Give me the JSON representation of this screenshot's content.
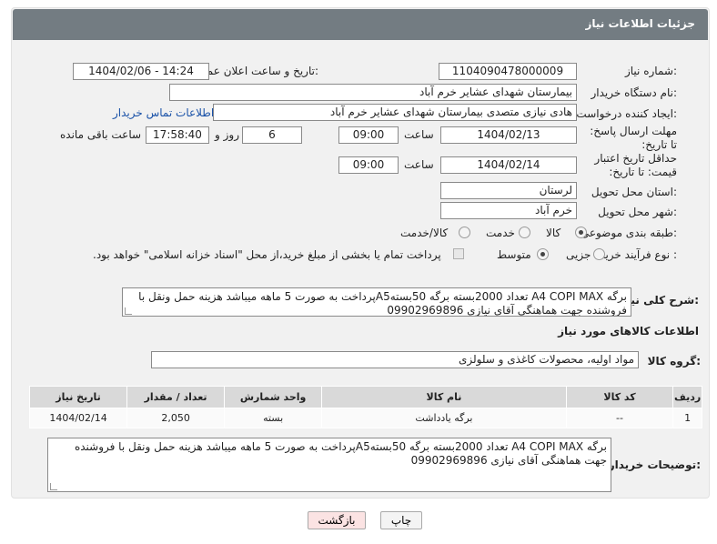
{
  "header": {
    "title": "جزئیات اطلاعات نیاز"
  },
  "labels": {
    "need_number": "شماره نیاز:",
    "announce_datetime": "تاریخ و ساعت اعلان عمومی:",
    "buyer_org": "نام دستگاه خریدار:",
    "requester": "ایجاد کننده درخواست:",
    "reply_deadline": "مهلت ارسال پاسخ: تا تاریخ:",
    "price_validity": "حداقل تاریخ اعتبار قیمت: تا تاریخ:",
    "hour": "ساعت",
    "day_and": "روز و",
    "hours_left": "ساعت باقی مانده",
    "province": "استان محل تحویل:",
    "city": "شهر محل تحویل:",
    "category": "طبقه بندی موضوعی:",
    "process_type": "نوع فرآیند خرید :",
    "general_desc": "شرح کلی نیاز:",
    "goods_info": "اطلاعات کالاهای مورد نیاز",
    "goods_group": "گروه کالا:",
    "buyer_notes": "توضیحات خریدار:"
  },
  "fields": {
    "need_number": "1104090478000009",
    "announce_datetime": "1404/02/06 - 14:24",
    "buyer_org": "بیمارستان شهدای عشایر خرم آباد",
    "requester": "هادی نیازی متصدی بیمارستان شهدای عشایر خرم آباد",
    "contact_link": "اطلاعات تماس خریدار",
    "reply_date": "1404/02/13",
    "reply_time": "09:00",
    "days_left": "6",
    "time_left": "17:58:40",
    "validity_date": "1404/02/14",
    "validity_time": "09:00",
    "province": "لرستان",
    "city": "خرم آباد",
    "goods_group": "مواد اولیه، محصولات کاغذی و سلولزی"
  },
  "category_options": [
    {
      "label": "کالا",
      "selected": true
    },
    {
      "label": "خدمت",
      "selected": false
    },
    {
      "label": "کالا/خدمت",
      "selected": false
    }
  ],
  "process_options": [
    {
      "label": "جزیی",
      "selected": false
    },
    {
      "label": "متوسط",
      "selected": true
    }
  ],
  "payment_note": "پرداخت تمام یا بخشی از مبلغ خرید،از محل \"اسناد خزانه اسلامی\" خواهد بود.",
  "general_desc_text": "برگه A4 COPI MAX  تعداد 2000بسته برگه  50بستهA5پرداخت به صورت 5 ماهه میباشد هزینه حمل ونقل با فروشنده جهت هماهنگی آقای نیازی 09902969896",
  "table": {
    "headers": [
      "ردیف",
      "کد کالا",
      "نام کالا",
      "واحد شمارش",
      "تعداد / مقدار",
      "تاریخ نیاز"
    ],
    "rows": [
      [
        "1",
        "--",
        "برگه یادداشت",
        "بسته",
        "2,050",
        "1404/02/14"
      ]
    ]
  },
  "buyer_notes_text": "برگه A4 COPI MAX  تعداد 2000بسته برگه  50بستهA5پرداخت به صورت 5 ماهه میباشد هزینه حمل ونقل با فروشنده جهت هماهنگی آقای نیازی 09902969896",
  "buttons": {
    "print": "چاپ",
    "back": "بازگشت"
  },
  "colors": {
    "header_bg": "#737c82",
    "link": "#1a52a8",
    "back_btn_bg": "#fbe3e3"
  }
}
